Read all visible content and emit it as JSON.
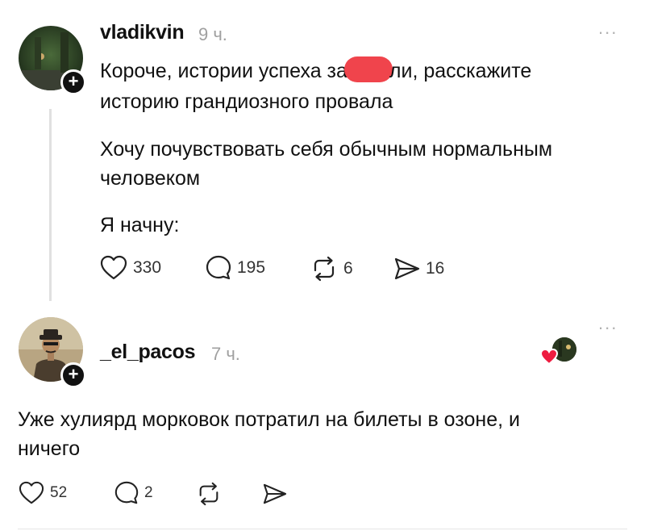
{
  "post": {
    "username": "vladikvin",
    "time": "9 ч.",
    "more": "...",
    "line1_a": "Короче, истории успеха за",
    "line1_b": "ли, расскажите",
    "line2": "историю грандиозного провала",
    "para2_line1": "Хочу почувствовать себя обычным нормальным",
    "para2_line2": "человеком",
    "para3": "Я начну:",
    "likes": "330",
    "comments": "195",
    "reposts": "6",
    "shares": "16",
    "redaction_color": "#f0444c"
  },
  "reply": {
    "username": "_el_pacos",
    "time": "7 ч.",
    "more": "...",
    "line1": "Уже хулиярд морковок потратил на билеты в озоне, и",
    "line2": "ничего",
    "likes": "52",
    "comments": "2"
  },
  "icons": {
    "plus": "+",
    "like": "heart-icon",
    "comment": "comment-bubble-icon",
    "repost": "repost-icon",
    "share": "send-icon",
    "liked_by_author": "heart-badge-icon"
  }
}
